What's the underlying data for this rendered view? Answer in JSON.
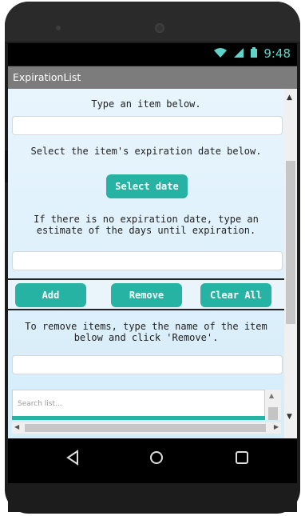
{
  "app": {
    "title": "ExpirationList"
  },
  "status": {
    "time": "9:48",
    "wifi_icon": "wifi-icon",
    "signal_icon": "signal-icon",
    "battery_icon": "battery-icon"
  },
  "main": {
    "label_item": "Type an item below.",
    "label_date": "Select the item's expiration date below.",
    "select_date_button": "Select date",
    "label_days_1": "If there is no expiration date, type an",
    "label_days_2": "estimate of the days until expiration.",
    "add_button": "Add",
    "remove_button": "Remove",
    "clear_all_button": "Clear All",
    "label_remove_1": "To remove items, type the name of the item",
    "label_remove_2": "below and click 'Remove'.",
    "search_placeholder": "Search list..."
  },
  "nav": {
    "back_icon": "back-icon",
    "home_icon": "home-icon",
    "recents_icon": "recents-icon"
  },
  "colors": {
    "accent": "#26b3a3",
    "app_bar": "#7c7c7c",
    "status_icon": "#5fd3c9"
  }
}
